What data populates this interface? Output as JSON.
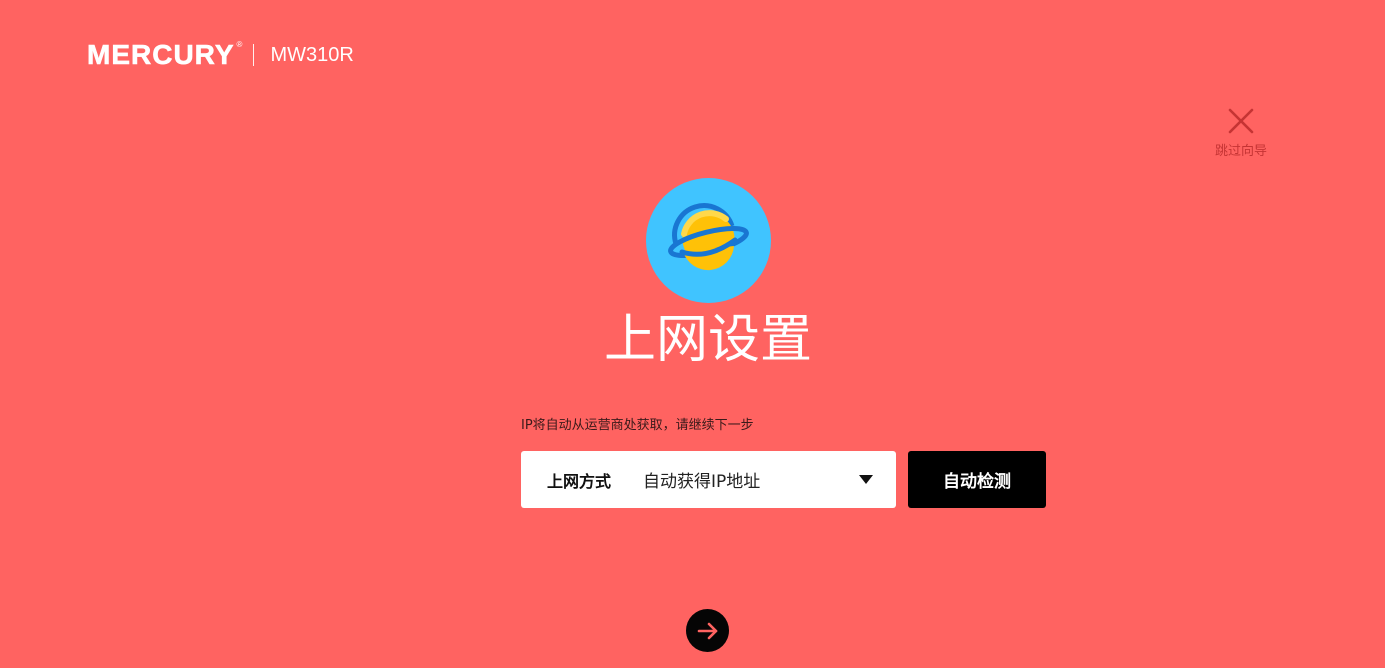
{
  "header": {
    "brand_logo": "MERCURY",
    "brand_reg_mark": "®",
    "model": "MW310R"
  },
  "skip_wizard": {
    "icon": "close-icon",
    "label": "跳过向导"
  },
  "hero": {
    "icon": "planet-icon",
    "title": "上网设置"
  },
  "form": {
    "hint": "IP将自动从运营商处获取，请继续下一步",
    "connection_type": {
      "label": "上网方式",
      "selected_value": "自动获得IP地址",
      "icon": "triangle-down-icon"
    },
    "detect_button_label": "自动检测"
  },
  "next_button": {
    "icon": "arrow-right-icon"
  },
  "colors": {
    "background": "#ff6361",
    "skip_label": "#c53434",
    "planet_background": "#40c4ff",
    "planet_body": "#ffc107",
    "planet_ring": "#1976d2",
    "button": "#000000"
  }
}
